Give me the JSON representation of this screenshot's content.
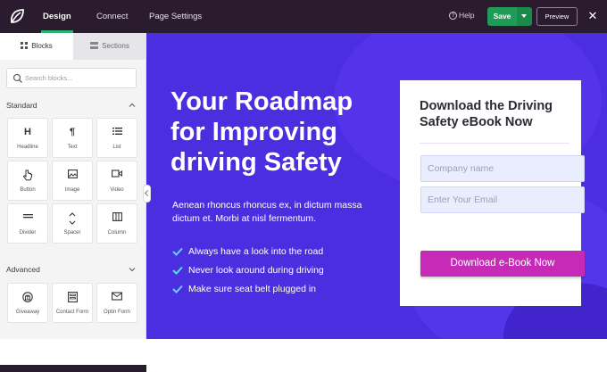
{
  "topbar": {
    "tabs": [
      {
        "label": "Design",
        "active": true
      },
      {
        "label": "Connect",
        "active": false
      },
      {
        "label": "Page Settings",
        "active": false
      }
    ],
    "help_label": "Help",
    "save_label": "Save",
    "preview_label": "Preview",
    "icons": {
      "logo": "seedprod-leaf-logo",
      "close": "close-icon",
      "save_menu": "chevron-down-icon"
    },
    "colors": {
      "bar": "#2a1b2e",
      "save": "#1f9b57",
      "active_tab_underline": "#2bb36f"
    }
  },
  "sidebar": {
    "tabs": [
      {
        "label": "Blocks",
        "icon": "grid-icon",
        "active": true
      },
      {
        "label": "Sections",
        "icon": "sections-icon",
        "active": false
      }
    ],
    "search": {
      "placeholder": "Search blocks..."
    },
    "sections": [
      {
        "title": "Standard",
        "blocks": [
          {
            "label": "Headline",
            "icon": "heading-icon"
          },
          {
            "label": "Text",
            "icon": "paragraph-icon"
          },
          {
            "label": "List",
            "icon": "list-icon"
          },
          {
            "label": "Button",
            "icon": "pointer-icon"
          },
          {
            "label": "Image",
            "icon": "image-icon"
          },
          {
            "label": "Video",
            "icon": "video-icon"
          },
          {
            "label": "Divider",
            "icon": "divider-icon"
          },
          {
            "label": "Spacer",
            "icon": "spacer-icon"
          },
          {
            "label": "Column",
            "icon": "column-icon"
          }
        ]
      },
      {
        "title": "Advanced",
        "blocks": [
          {
            "label": "Giveaway",
            "icon": "giveaway-icon"
          },
          {
            "label": "Contact Form",
            "icon": "contact-form-icon"
          },
          {
            "label": "Optin Form",
            "icon": "envelope-icon"
          }
        ]
      }
    ]
  },
  "canvas": {
    "background": "#4a2ee0",
    "hero": {
      "title_lines": [
        "Your Roadmap",
        "for Improving",
        "driving Safety"
      ],
      "subtitle_lines": [
        "Aenean rhoncus rhoncus ex, in dictum massa",
        "dictum et. Morbi at nisl fermentum."
      ],
      "checklist": [
        "Always have a look into the road",
        "Never look around during driving",
        "Make sure seat belt plugged in"
      ],
      "check_color": "#5fd6f5"
    },
    "form": {
      "title_lines": [
        "Download the Driving",
        "Safety eBook Now"
      ],
      "fields": [
        {
          "placeholder": "Company name"
        },
        {
          "placeholder": "Enter Your Email"
        }
      ],
      "cta_label": "Download e-Book Now",
      "cta_color": "#c72ab7"
    }
  }
}
